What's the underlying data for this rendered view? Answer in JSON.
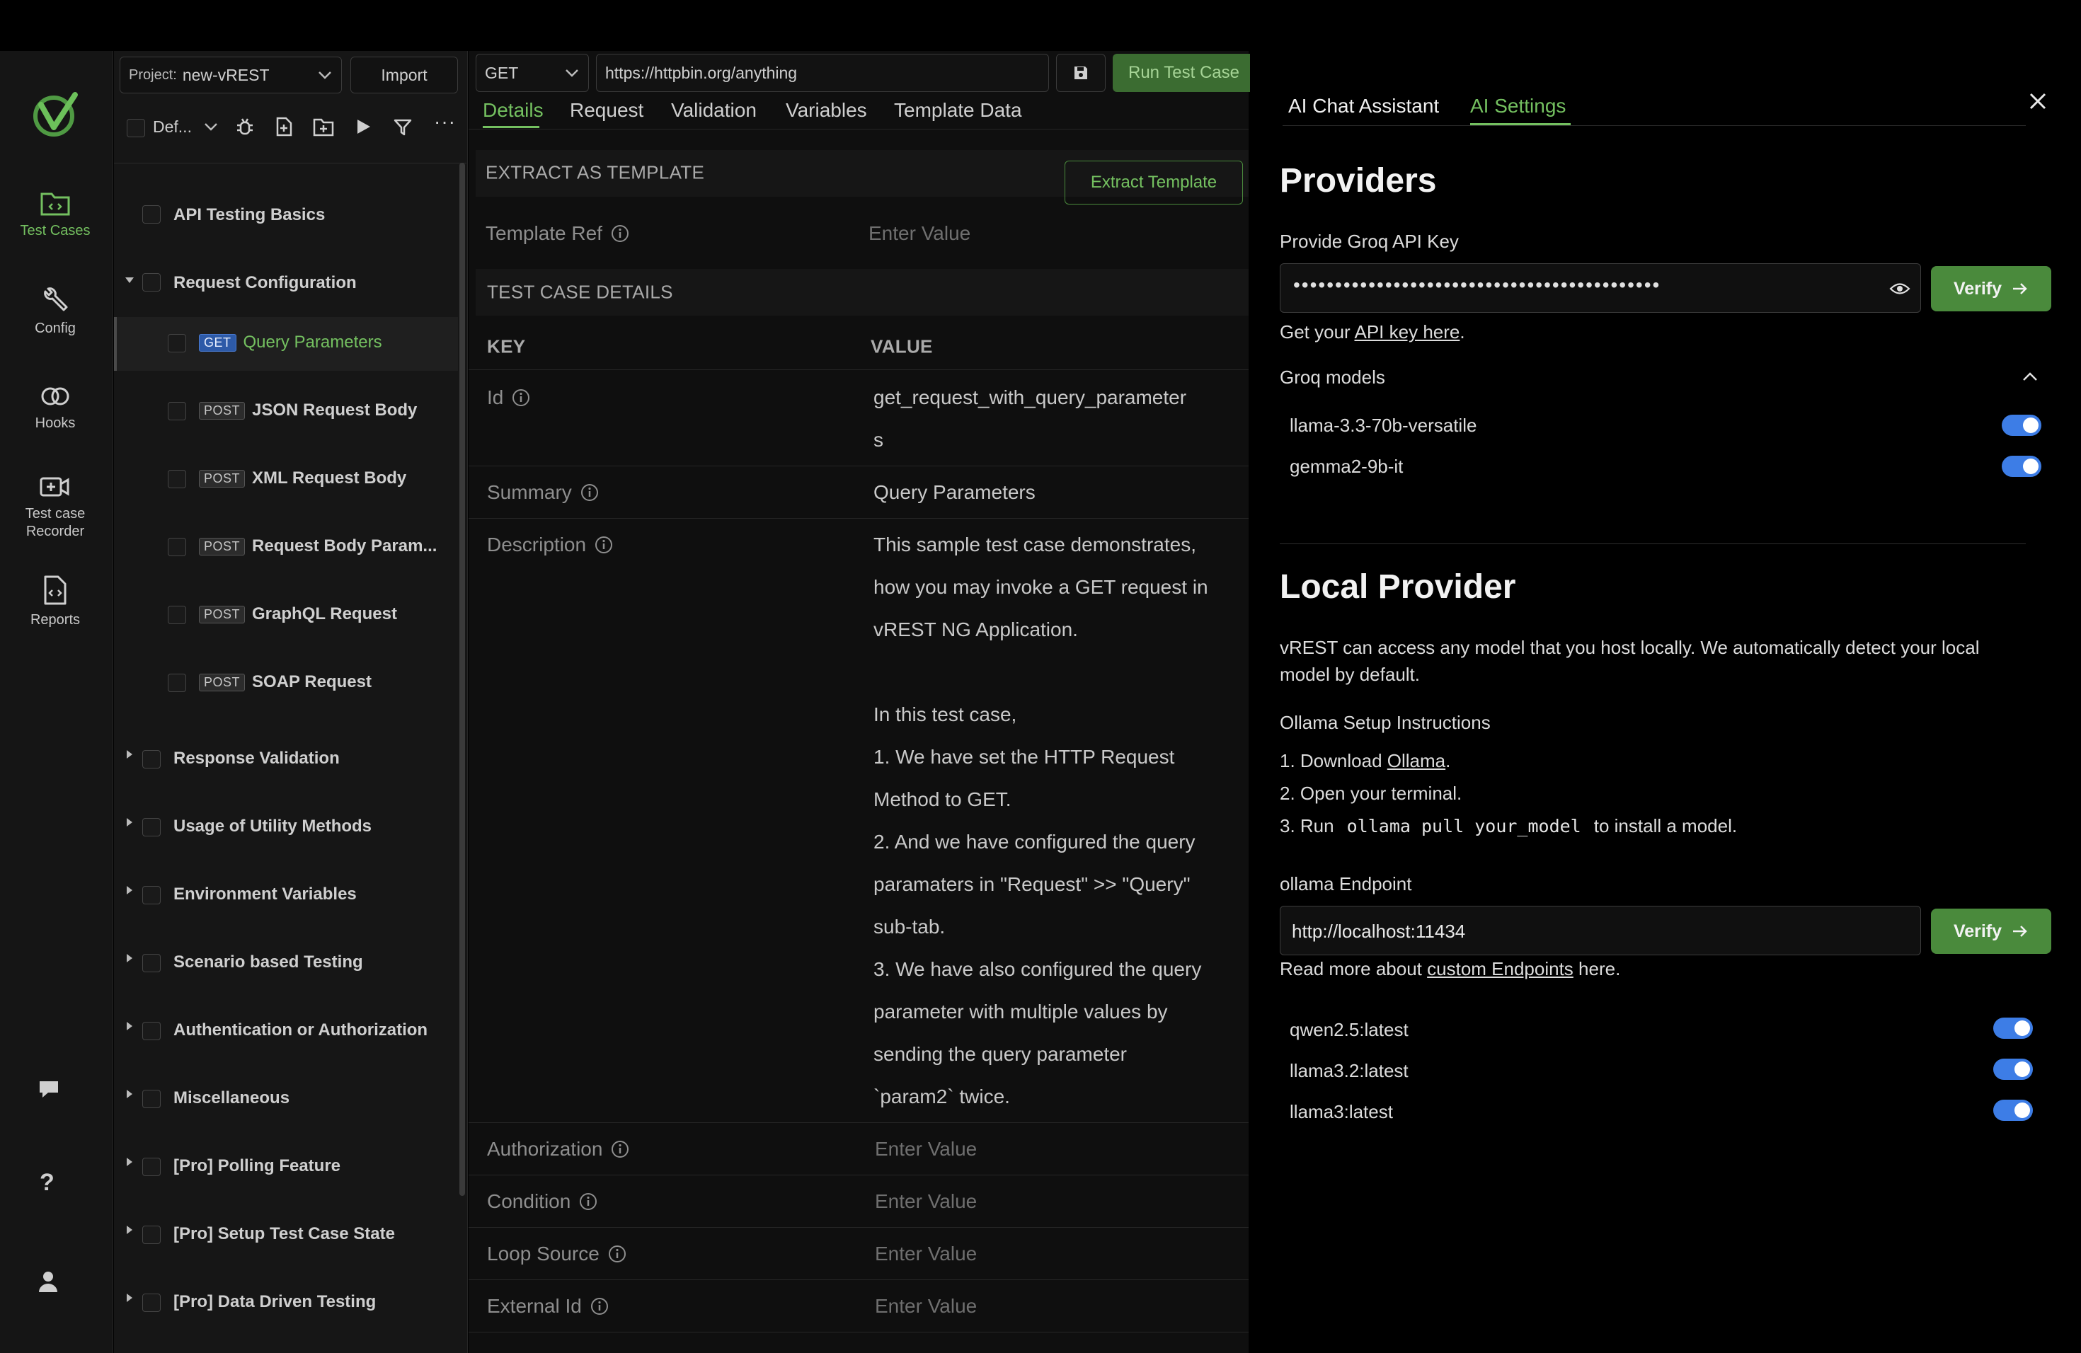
{
  "rail": {
    "items": [
      {
        "label": "Test Cases",
        "icon": "folder-code-icon"
      },
      {
        "label": "Config",
        "icon": "wrench-icon"
      },
      {
        "label": "Hooks",
        "icon": "link-icon"
      },
      {
        "label": "Test case Recorder",
        "icon": "video-plus-icon"
      },
      {
        "label": "Reports",
        "icon": "file-code-icon"
      }
    ]
  },
  "tree": {
    "project_prefix": "Project:",
    "project_name": "new-vREST",
    "import_label": "Import",
    "filter_label": "Def...",
    "items": [
      {
        "label": "API Testing Basics"
      },
      {
        "label": "Request Configuration"
      },
      {
        "label": "Response Validation"
      },
      {
        "label": "Usage of Utility Methods"
      },
      {
        "label": "Environment Variables"
      },
      {
        "label": "Scenario based Testing"
      },
      {
        "label": "Authentication or Authorization"
      },
      {
        "label": "Miscellaneous"
      },
      {
        "label": "[Pro] Polling Feature"
      },
      {
        "label": "[Pro] Setup Test Case State"
      },
      {
        "label": "[Pro] Data Driven Testing"
      }
    ],
    "children": [
      {
        "method": "GET",
        "label": "Query Parameters"
      },
      {
        "method": "POST",
        "label": "JSON Request Body"
      },
      {
        "method": "POST",
        "label": "XML Request Body"
      },
      {
        "method": "POST",
        "label": "Request Body Param..."
      },
      {
        "method": "POST",
        "label": "GraphQL Request"
      },
      {
        "method": "POST",
        "label": "SOAP Request"
      }
    ]
  },
  "main": {
    "method": "GET",
    "url": "https://httpbin.org/anything",
    "run_label": "Run Test Case",
    "tabs": [
      "Details",
      "Request",
      "Validation",
      "Variables",
      "Template Data"
    ],
    "extract_header": "EXTRACT AS TEMPLATE",
    "extract_button": "Extract Template",
    "template_ref_label": "Template Ref",
    "template_ref_placeholder": "Enter Value",
    "details_header": "TEST CASE DETAILS",
    "key_header": "KEY",
    "value_header": "VALUE",
    "id_label": "Id",
    "id_value_1": "get_request_with_query_parameter",
    "id_value_2": "s",
    "summary_label": "Summary",
    "summary_value": "Query Parameters",
    "description_label": "Description",
    "description_lines": [
      "This sample test case demonstrates,",
      "how you may invoke a GET request in",
      "vREST NG Application.",
      "",
      "In this test case,",
      "1. We have set the HTTP Request",
      "Method to GET.",
      "2. And we have configured the query",
      "paramaters in \"Request\" >> \"Query\"",
      "sub-tab.",
      "3. We have also configured the query",
      "parameter with multiple values by",
      "sending the query parameter",
      "`param2` twice."
    ],
    "authorization_label": "Authorization",
    "condition_label": "Condition",
    "loop_source_label": "Loop Source",
    "external_id_label": "External Id",
    "enter_value": "Enter Value"
  },
  "panel": {
    "tab_chat": "AI Chat Assistant",
    "tab_settings": "AI Settings",
    "providers_title": "Providers",
    "groq_key_label": "Provide Groq API Key",
    "groq_key_masked": "••••••••••••••••••••••••••••••••••••••••••••",
    "verify_label": "Verify",
    "get_your": "Get your ",
    "api_key_link": "API key here",
    "period": ".",
    "groq_models_label": "Groq models",
    "groq_models": [
      "llama-3.3-70b-versatile",
      "gemma2-9b-it"
    ],
    "local_title": "Local Provider",
    "local_desc_1": "vREST can access any model that you host locally. We automatically detect your local",
    "local_desc_2": "model by default.",
    "ollama_setup": "Ollama Setup Instructions",
    "step1_prefix": "1. Download ",
    "step1_link": "Ollama",
    "step2": "2. Open your terminal.",
    "step3_prefix": "3. Run",
    "step3_code": "ollama pull your_model",
    "step3_suffix": "to install a model.",
    "endpoint_label": "ollama Endpoint",
    "endpoint_value": "http://localhost:11434",
    "read_more_prefix": "Read more about ",
    "read_more_link": "custom Endpoints",
    "read_more_suffix": " here.",
    "local_models": [
      "qwen2.5:latest",
      "llama3.2:latest",
      "llama3:latest"
    ]
  },
  "colors": {
    "accent_green": "#74c060",
    "button_green": "#4a8a3c",
    "toggle_blue": "#3d7de6"
  }
}
